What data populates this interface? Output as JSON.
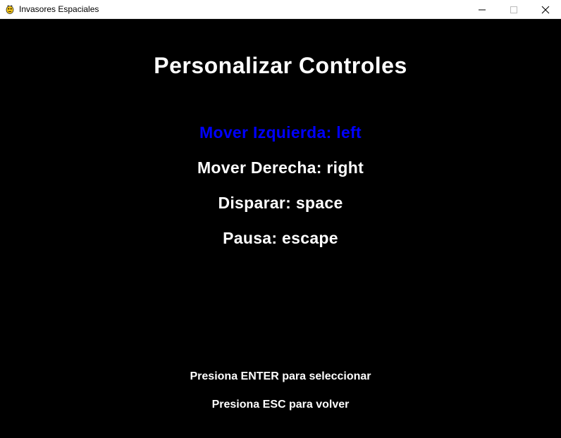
{
  "window": {
    "title": "Invasores Espaciales",
    "app_icon": "pygame-snake-icon",
    "buttons": [
      "minimize-icon",
      "maximize-icon",
      "close-icon"
    ]
  },
  "screen": {
    "heading": "Personalizar Controles",
    "options": [
      {
        "label": "Mover Izquierda: left",
        "selected": true
      },
      {
        "label": "Mover Derecha: right",
        "selected": false
      },
      {
        "label": "Disparar: space",
        "selected": false
      },
      {
        "label": "Pausa: escape",
        "selected": false
      }
    ],
    "hints": [
      "Presiona ENTER para seleccionar",
      "Presiona ESC para volver"
    ]
  },
  "colors": {
    "background": "#000000",
    "text": "#ffffff",
    "selected": "#0000ff"
  }
}
